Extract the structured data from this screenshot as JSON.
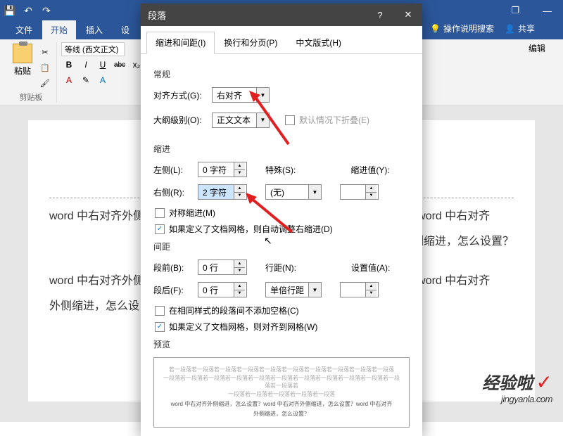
{
  "word": {
    "menu": {
      "file": "文件",
      "home": "开始",
      "insert": "插入",
      "design": "设",
      "help_search": "操作说明搜索",
      "share": "共享"
    },
    "ribbon": {
      "paste": "粘贴",
      "clipboard_label": "剪贴板",
      "font_name": "等线 (西文正文)",
      "bold": "B",
      "italic": "I",
      "underline": "U",
      "strike": "abc",
      "edit_label": "编辑"
    },
    "doc": {
      "line1": "word 中右对齐外侧",
      "line1_right": "设置？word 中右对齐",
      "line2_right": "外侧缩进，怎么设置？",
      "line3": "word 中右对齐外侧",
      "line3_right": "设置？word 中右对齐",
      "line4": "外侧缩进，怎么设"
    }
  },
  "dialog": {
    "title": "段落",
    "tabs": {
      "indent": "缩进和间距(I)",
      "page": "换行和分页(P)",
      "chinese": "中文版式(H)"
    },
    "sections": {
      "general": "常规",
      "indent": "缩进",
      "spacing": "间距",
      "preview": "预览"
    },
    "general": {
      "align_label": "对齐方式(G):",
      "align_value": "右对齐",
      "outline_label": "大纲级别(O):",
      "outline_value": "正文文本",
      "collapse_label": "默认情况下折叠(E)"
    },
    "indent": {
      "left_label": "左侧(L):",
      "left_value": "0 字符",
      "right_label": "右侧(R):",
      "right_value": "2 字符",
      "special_label": "特殊(S):",
      "special_value": "(无)",
      "indent_val_label": "缩进值(Y):",
      "mirror_label": "对称缩进(M)",
      "grid_label": "如果定义了文档网格，则自动调整右缩进(D)"
    },
    "spacing": {
      "before_label": "段前(B):",
      "before_value": "0 行",
      "after_label": "段后(F):",
      "after_value": "0 行",
      "line_label": "行距(N):",
      "line_value": "单倍行距",
      "setat_label": "设置值(A):",
      "nospace_label": "在相同样式的段落间不添加空格(C)",
      "grid_label": "如果定义了文档网格，则对齐到网格(W)"
    },
    "preview": {
      "gray1": "若一段落若一段落若一段落若一段落若一段落若一段落若一段落若一段落若一段落若一段落",
      "gray2": "一段落若一段落若一段落若一段落若一段落若一段落若一段落若一段落若一段落若一段落若一段落若一段落若",
      "gray3": "一段落若一段落若一段落若一段落若一段落",
      "main1": "word 中右对齐外侧缩进，怎么设置？word 中右对齐外侧缩进，怎么设置？word 中右对齐",
      "main2": "外侧缩进，怎么设置？"
    }
  },
  "watermark": {
    "main": "经验啦",
    "sub": "jingyanla.com"
  }
}
